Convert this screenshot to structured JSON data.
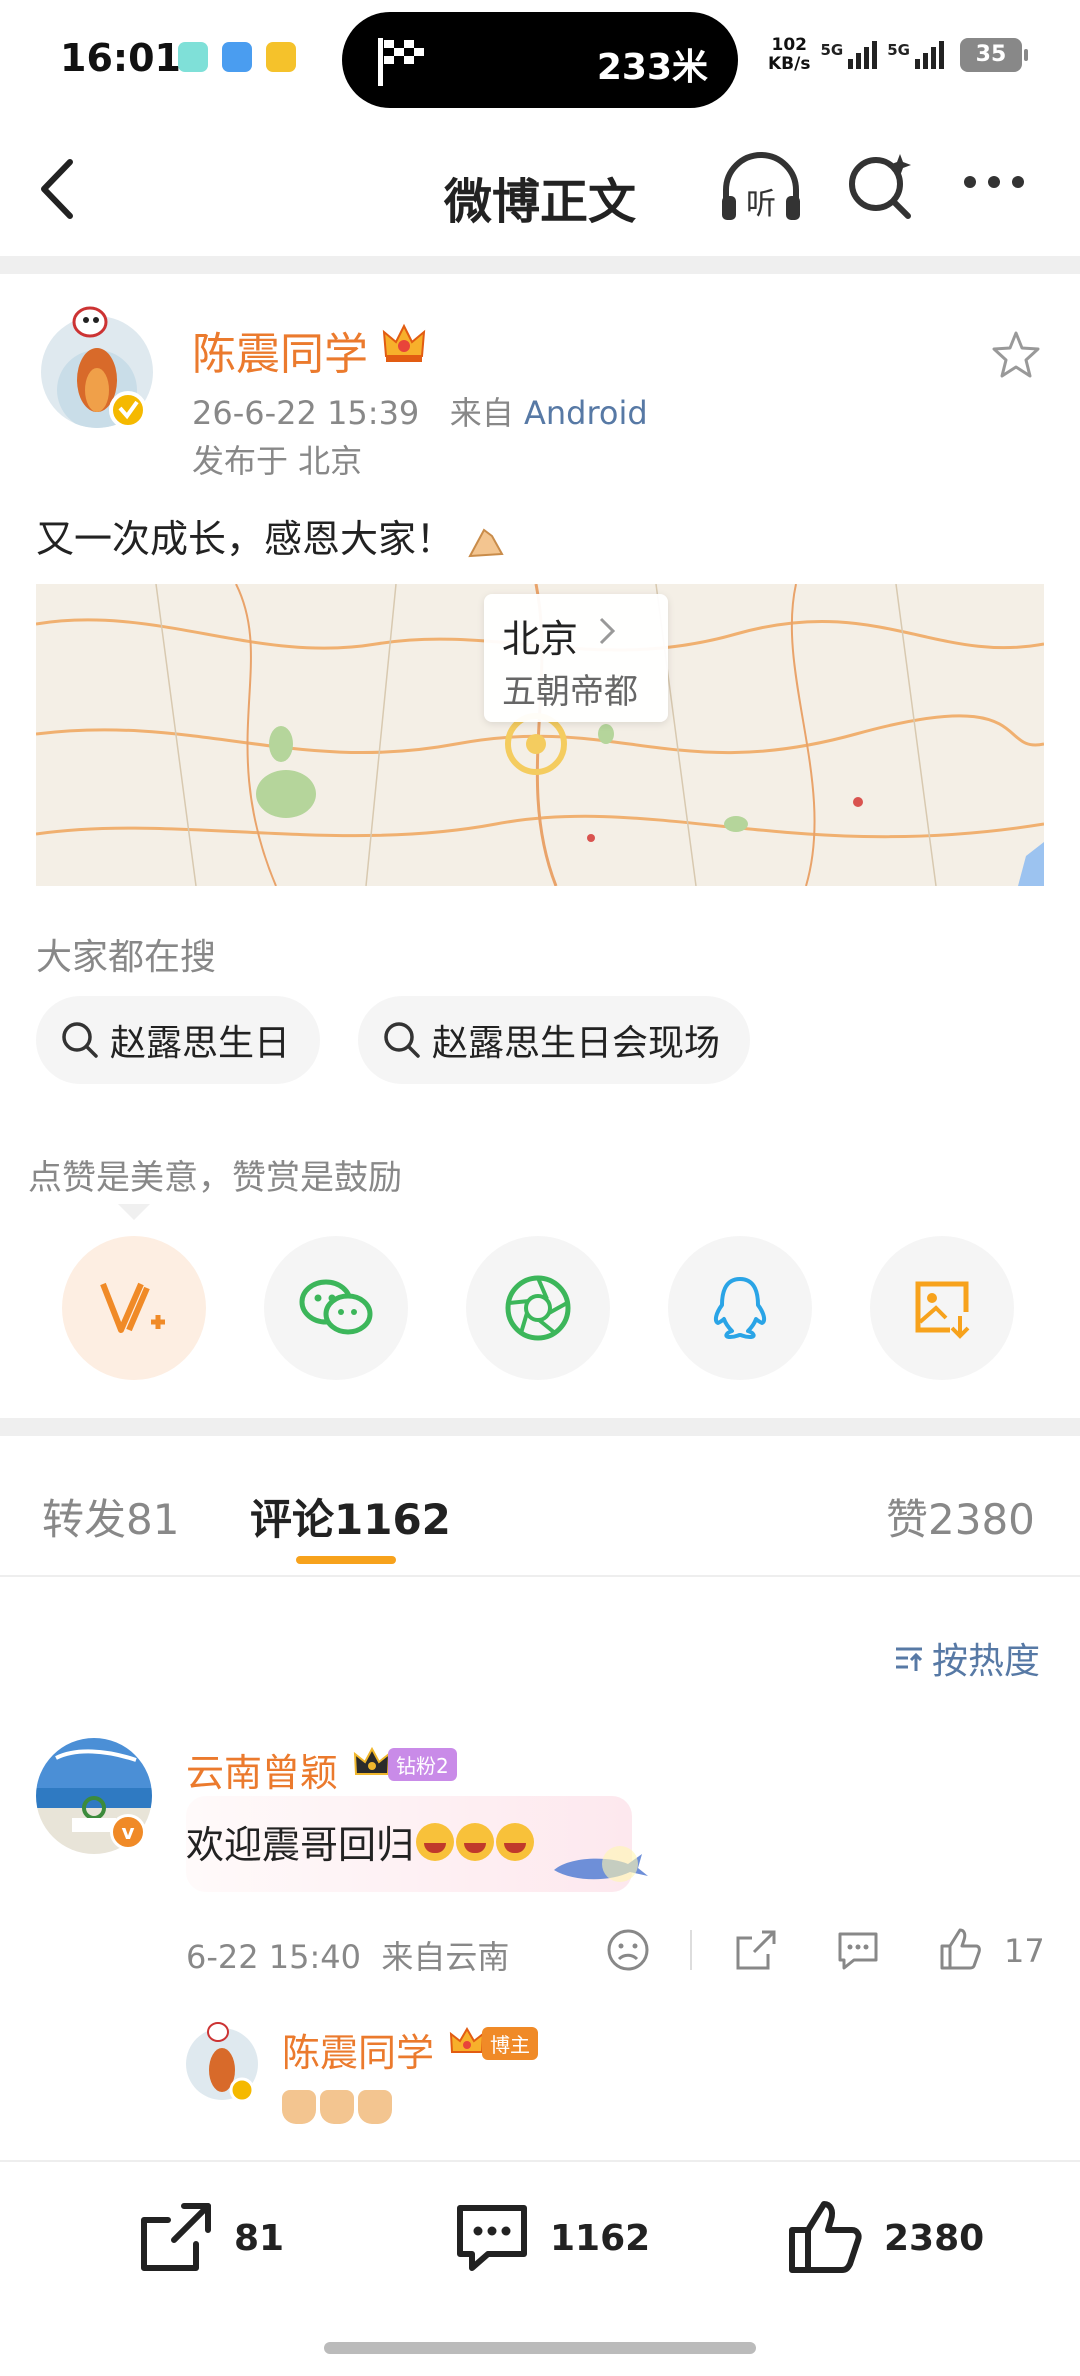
{
  "status_bar": {
    "time": "16:01",
    "distance": "233米",
    "net_speed_value": "102",
    "net_speed_unit": "KB/s",
    "sim1": "5G",
    "sim2": "5G",
    "battery": "35"
  },
  "header": {
    "title": "微博正文",
    "listen_label": "听"
  },
  "post": {
    "author": "陈震同学",
    "time": "26-6-22 15:39",
    "source_prefix": "来自",
    "source": "Android",
    "location": "发布于 北京",
    "content": "又一次成长，感恩大家！",
    "map": {
      "city": "北京",
      "subtitle": "五朝帝都"
    }
  },
  "hot_search": {
    "title": "大家都在搜",
    "items": [
      "赵露思生日",
      "赵露思生日会现场"
    ]
  },
  "reward": {
    "tip": "点赞是美意，赞赏是鼓励",
    "share_targets": [
      "reward",
      "wechat",
      "moments",
      "qq",
      "save-image"
    ]
  },
  "tabs": {
    "repost_label": "转发",
    "repost_count": "81",
    "comment_label": "评论",
    "comment_count": "1162",
    "like_label": "赞",
    "like_count": "2380",
    "active": "comment"
  },
  "sort": {
    "label": "按热度"
  },
  "comment": {
    "author": "云南曾颖",
    "badge": "钻粉2",
    "text": "欢迎震哥回归",
    "time": "6-22 15:40",
    "location": "来自云南",
    "likes": "17"
  },
  "reply": {
    "author": "陈震同学",
    "badge": "博主"
  },
  "bottom_bar": {
    "repost": "81",
    "comment": "1162",
    "like": "2380"
  },
  "colors": {
    "accent": "#eb7a2d",
    "link": "#5779a5",
    "tab_indicator": "#f7a21c"
  }
}
